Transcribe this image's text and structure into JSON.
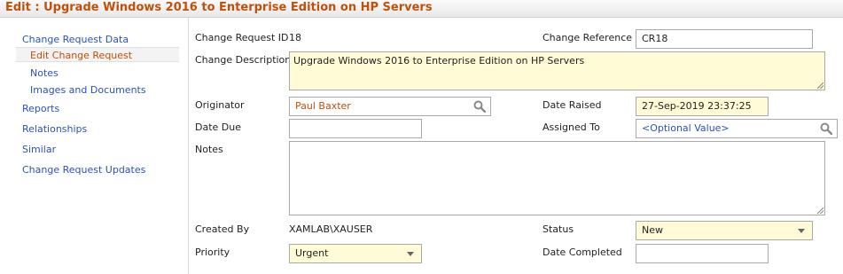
{
  "title": "Edit : Upgrade Windows 2016 to Enterprise Edition on HP Servers",
  "sidebar": {
    "items": [
      {
        "label": "Change Request Data"
      },
      {
        "label": "Edit Change Request"
      },
      {
        "label": "Notes"
      },
      {
        "label": "Images and Documents"
      },
      {
        "label": "Reports"
      },
      {
        "label": "Relationships"
      },
      {
        "label": "Similar"
      },
      {
        "label": "Change Request Updates"
      }
    ]
  },
  "form": {
    "change_request_id": {
      "label": "Change Request ID",
      "value": "18"
    },
    "change_reference": {
      "label": "Change Reference",
      "value": "CR18"
    },
    "change_description": {
      "label": "Change Description",
      "value": "Upgrade Windows 2016 to Enterprise Edition on HP Servers"
    },
    "originator": {
      "label": "Originator",
      "value": "Paul Baxter"
    },
    "date_raised": {
      "label": "Date Raised",
      "value": "27-Sep-2019 23:37:25"
    },
    "date_due": {
      "label": "Date Due",
      "value": ""
    },
    "assigned_to": {
      "label": "Assigned To",
      "value": "<Optional Value>"
    },
    "notes": {
      "label": "Notes",
      "value": ""
    },
    "created_by": {
      "label": "Created By",
      "value": "XAMLAB\\XAUSER"
    },
    "status": {
      "label": "Status",
      "value": "New"
    },
    "priority": {
      "label": "Priority",
      "value": "Urgent"
    },
    "date_completed": {
      "label": "Date Completed",
      "value": ""
    }
  },
  "colors": {
    "accent": "#c0500a",
    "link": "#2a52be",
    "highlight_field": "#fffbd6"
  },
  "icons": {
    "lookup": "search-icon",
    "dropdown": "chevron-down-icon",
    "resize": "resize-grip-icon"
  }
}
